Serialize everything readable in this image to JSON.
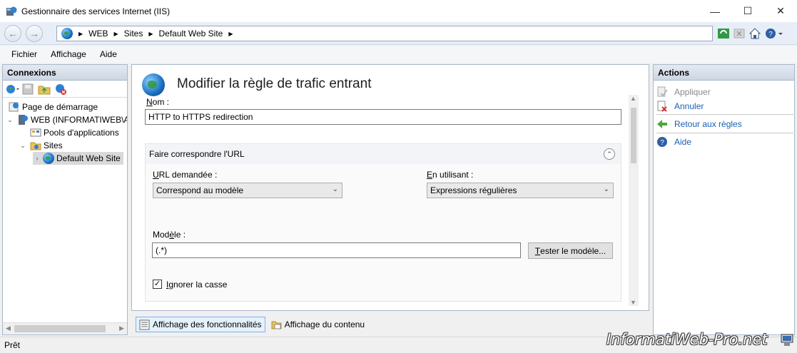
{
  "window": {
    "title": "Gestionnaire des services Internet (IIS)",
    "minimize": "—",
    "maximize": "☐",
    "close": "✕"
  },
  "nav": {
    "back": "←",
    "forward": "→"
  },
  "address": {
    "crumbs": [
      "WEB",
      "Sites",
      "Default Web Site"
    ]
  },
  "menu": {
    "items": [
      "Fichier",
      "Affichage",
      "Aide"
    ]
  },
  "connections": {
    "title": "Connexions",
    "tree": [
      {
        "label": "Page de démarrage"
      },
      {
        "label": "WEB (INFORMATIWEB\\A"
      },
      {
        "label": "Pools d'applications"
      },
      {
        "label": "Sites"
      },
      {
        "label": "Default Web Site"
      }
    ]
  },
  "main": {
    "title": "Modifier la règle de trafic entrant",
    "name_label_prefix": "N",
    "name_label_rest": "om :",
    "name_value": "HTTP to HTTPS redirection",
    "section_title": "Faire correspondre l'URL",
    "url_label_prefix": "U",
    "url_label_rest": "RL demandée :",
    "url_value": "Correspond au modèle",
    "using_label_prefix": "E",
    "using_label_rest": "n utilisant :",
    "using_value": "Expressions régulières",
    "pattern_label_prefix": "Mod",
    "pattern_label_underlined": "è",
    "pattern_label_rest": "le :",
    "pattern_value": "(.*)",
    "test_button_prefix": "T",
    "test_button_rest": "ester le modèle...",
    "ignore_case_checked": true,
    "ignore_case_prefix": "I",
    "ignore_case_rest": "gnorer la casse",
    "checkmark": "✓"
  },
  "view_tabs": {
    "features": "Affichage des fonctionnalités",
    "content": "Affichage du contenu"
  },
  "actions": {
    "title": "Actions",
    "apply": "Appliquer",
    "cancel": "Annuler",
    "back_to_rules": "Retour aux règles",
    "help": "Aide"
  },
  "status": {
    "text": "Prêt"
  },
  "watermark": {
    "text": "InformatiWeb-Pro.net"
  },
  "colors": {
    "link": "#1a5fb4",
    "disabled": "#8a8a8a",
    "panel_header": "#dbe3ee"
  }
}
